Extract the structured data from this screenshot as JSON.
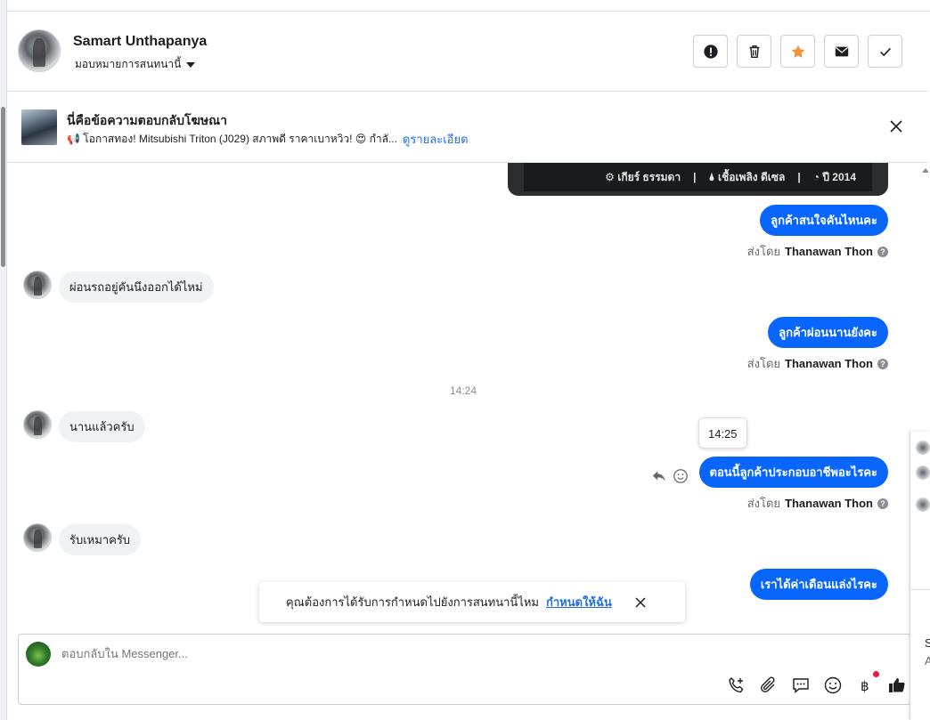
{
  "header": {
    "name": "Samart Unthapanya",
    "assign": "มอบหมายการสนทนานี้",
    "actions": [
      {
        "icon": "alert-icon"
      },
      {
        "icon": "trash-icon"
      },
      {
        "icon": "star-icon",
        "color": "#f7923b"
      },
      {
        "icon": "mail-icon"
      },
      {
        "icon": "check-icon"
      }
    ]
  },
  "ad": {
    "title": "นี่คือข้อความตอบกลับโฆษณา",
    "description": "📢 โอกาสทอง! Mitsubishi Triton (J029) สภาพดี ราคาเบาหวิว! 😍 กำลั...",
    "link": "ดูรายละเอียด"
  },
  "card": {
    "gear": "⚙ เกียร์ ธรรมดา",
    "fuel": "🌢 เชื้อเพลิง ดีเซล",
    "year": "◔ ปี 2014",
    "sep": "|"
  },
  "messages": {
    "out1": "ลูกค้าสนใจคันไหนคะ",
    "in1": "ผ่อนรถอยู่คันนึงออกได้ไหม่",
    "out2": "ลูกค้าผ่อนนานยังคะ",
    "time1": "14:24",
    "in2": "นานแล้วครับ",
    "tooltip": "14:25",
    "out3": "ตอนนี้ลูกค้าประกอบอาชีพอะไรคะ",
    "in3": "รับเหมาครับ",
    "out4": "เราได้ค่าเดือนแล่งไรคะ",
    "sent_by_label": "ส่งโดย",
    "sent_by_name": "Thanawan Thon",
    "qmark": "?"
  },
  "toast": {
    "text": "คุณต้องการได้รับการกำหนดไปยังการสนทนานี้ไหม",
    "link": "กำหนดให้ฉัน"
  },
  "composer": {
    "placeholder": "ตอบกลับใน Messenger..."
  },
  "colors": {
    "accent": "#0866ff",
    "link": "#216fdb",
    "star": "#f7923b"
  },
  "right_panel": {
    "letter1": "S",
    "letter2": "A"
  }
}
